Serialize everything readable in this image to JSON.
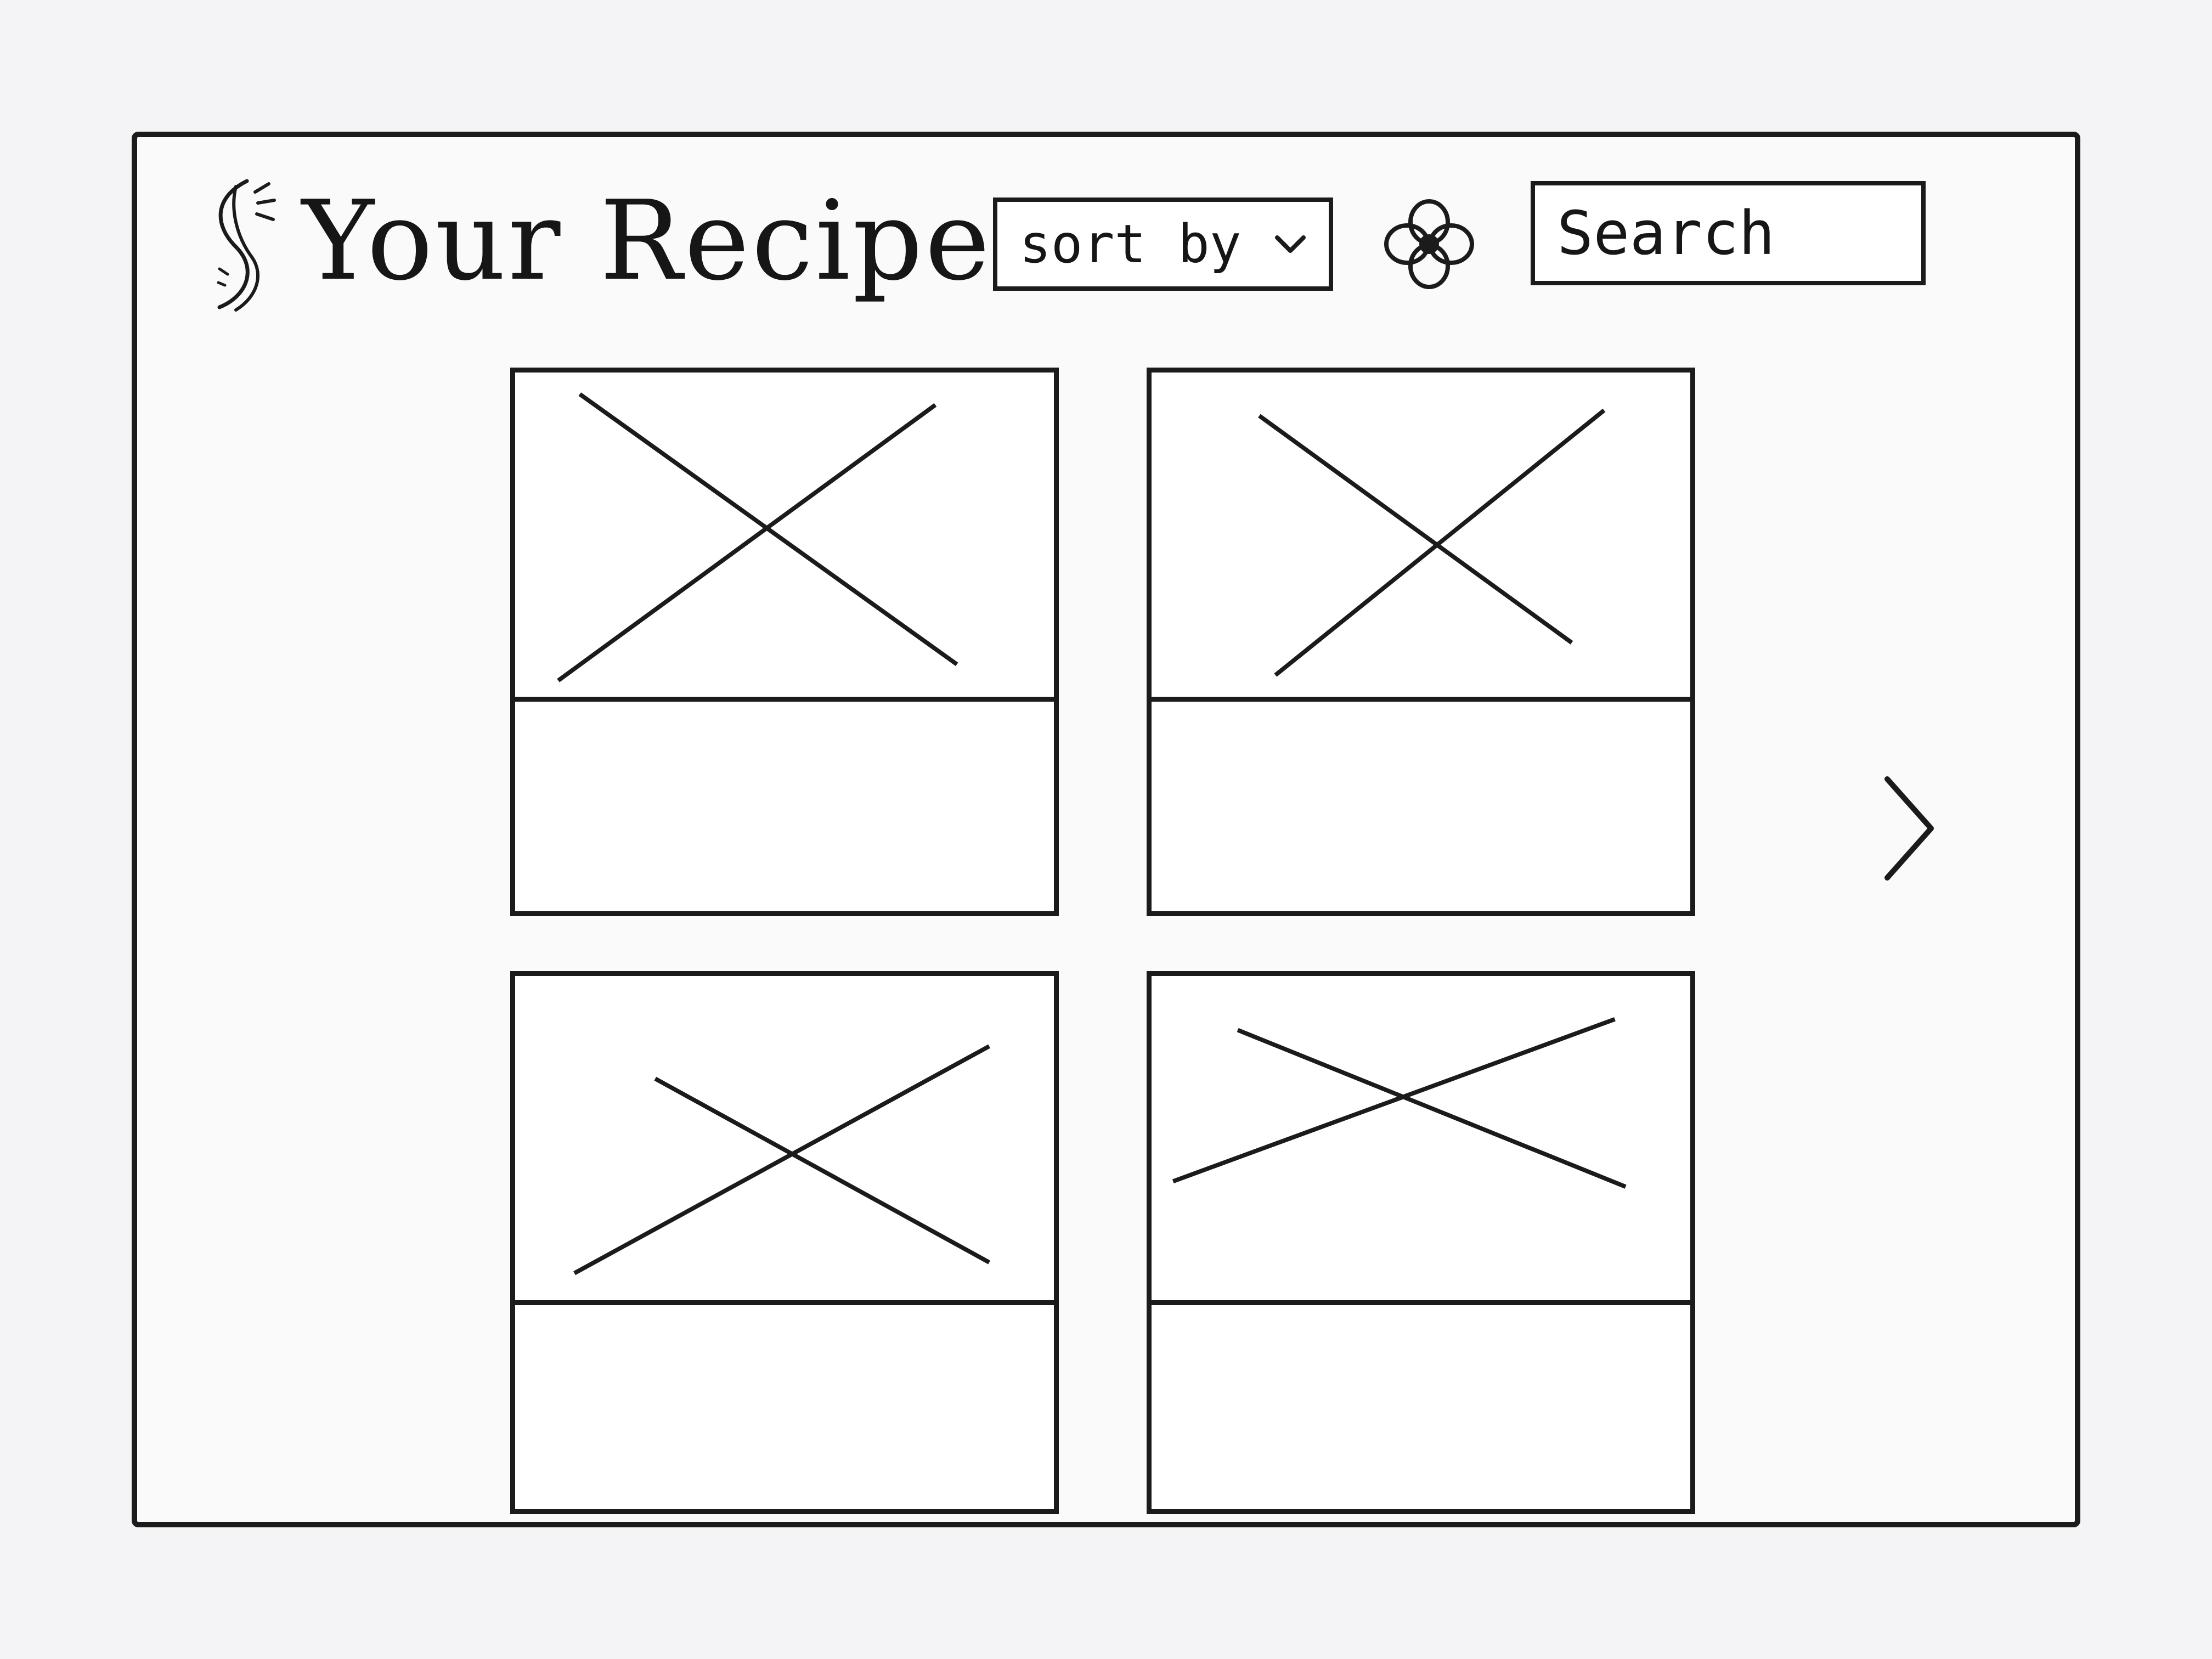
{
  "header": {
    "title": "Your Recipes",
    "sort": {
      "label": "sort by",
      "icon": "chevron-down-icon"
    },
    "filter": {
      "icon": "flower-filter-icon"
    },
    "search": {
      "placeholder": "Search",
      "value": ""
    }
  },
  "recipes": [
    {
      "image": "image-placeholder-icon",
      "title": ""
    },
    {
      "image": "image-placeholder-icon",
      "title": ""
    },
    {
      "image": "image-placeholder-icon",
      "title": ""
    },
    {
      "image": "image-placeholder-icon",
      "title": ""
    }
  ],
  "pagination": {
    "next_icon": "chevron-right-icon"
  },
  "colors": {
    "ink": "#1b1b1b",
    "paper": "#fafafa"
  }
}
